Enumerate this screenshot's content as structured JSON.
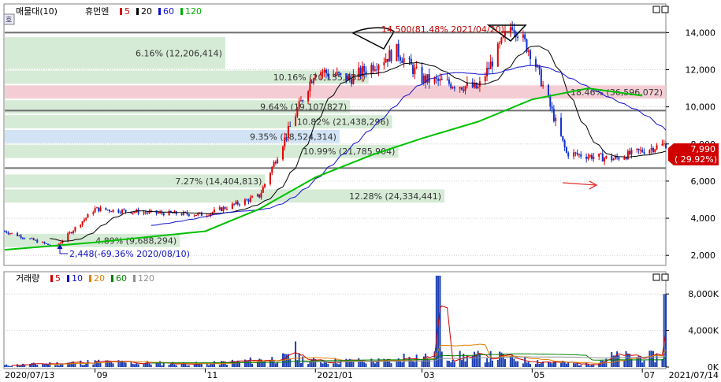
{
  "price_panel": {
    "legend": {
      "title": "매물대(10)",
      "stock": "휴먼엔",
      "ma": [
        {
          "label": "5",
          "color": "#d00000"
        },
        {
          "label": "20",
          "color": "#000000"
        },
        {
          "label": "60",
          "color": "#1010d0"
        },
        {
          "label": "120",
          "color": "#00b000"
        }
      ]
    },
    "y_ticks": [
      "14,000",
      "12,000",
      "10,000",
      "8,000",
      "6,000",
      "4,000",
      "2,000"
    ],
    "current_price": {
      "value": "7,990",
      "change": "( 29.92%)"
    },
    "annotations": {
      "high": "14,500(81.48% 2021/04/20)",
      "low": "2,448(-69.36% 2020/08/10)"
    }
  },
  "volume_panel": {
    "legend": {
      "title": "거래량",
      "ma": [
        {
          "label": "5",
          "color": "#d00000"
        },
        {
          "label": "10",
          "color": "#1010d0"
        },
        {
          "label": "20",
          "color": "#e08000"
        },
        {
          "label": "60",
          "color": "#008000"
        },
        {
          "label": "120",
          "color": "#909090"
        }
      ]
    },
    "y_ticks": [
      "8,000K",
      "4,000K",
      "0K"
    ]
  },
  "x_axis": {
    "labels": [
      "2020/07/13",
      "09",
      "11",
      "2021/01",
      "03",
      "05",
      "07",
      "2021/07/14"
    ]
  },
  "chart_data": {
    "type": "candlestick",
    "title": "휴먼엔",
    "x_range": [
      "2020/07/13",
      "2021/07/14"
    ],
    "ylim": [
      1500,
      15500
    ],
    "volume_profile": [
      {
        "label": "6.16% (12,206,414)",
        "price_low": 12000,
        "price_high": 13800,
        "share": 6.16,
        "volume": 12206414
      },
      {
        "label": "10.16% (20,135,435)",
        "price_low": 11200,
        "price_high": 12000,
        "share": 10.16,
        "volume": 20135435
      },
      {
        "label": "18.46% (36,596,072)",
        "price_low": 10400,
        "price_high": 11200,
        "share": 18.46,
        "volume": 36596072,
        "highlight": true
      },
      {
        "label": "9.64% (19,107,827)",
        "price_low": 9600,
        "price_high": 10400,
        "share": 9.64,
        "volume": 19107827
      },
      {
        "label": "10.82% (21,438,296)",
        "price_low": 8800,
        "price_high": 9600,
        "share": 10.82,
        "volume": 21438296
      },
      {
        "label": "9.35% (18,524,314)",
        "price_low": 8000,
        "price_high": 8800,
        "share": 9.35,
        "volume": 18524314,
        "current": true
      },
      {
        "label": "10.99% (21,785,904)",
        "price_low": 7200,
        "price_high": 8000,
        "share": 10.99,
        "volume": 21785904
      },
      {
        "label": "7.27% (14,404,813)",
        "price_low": 5600,
        "price_high": 6400,
        "share": 7.27,
        "volume": 14404813
      },
      {
        "label": "12.28% (24,334,441)",
        "price_low": 4800,
        "price_high": 5600,
        "share": 12.28,
        "volume": 24334441
      },
      {
        "label": "4.89% (9,688,294)",
        "price_low": 2400,
        "price_high": 3200,
        "share": 4.89,
        "volume": 9688294
      }
    ],
    "horizontal_lines": [
      14000,
      9800,
      6700
    ],
    "price_series": {
      "dates": [
        "2020/07/13",
        "2020/08/10",
        "2020/09/01",
        "2020/10/01",
        "2020/11/01",
        "2020/12/01",
        "2021/01/01",
        "2021/01/20",
        "2021/02/15",
        "2021/03/01",
        "2021/04/01",
        "2021/04/20",
        "2021/05/01",
        "2021/05/20",
        "2021/06/15",
        "2021/07/14"
      ],
      "close": [
        3300,
        2448,
        4500,
        4300,
        4200,
        5200,
        12000,
        11500,
        13000,
        11500,
        11000,
        14500,
        12800,
        7500,
        7200,
        7990
      ]
    },
    "ma120": {
      "dates": [
        "2020/07/13",
        "2020/09/01",
        "2020/11/01",
        "2020/12/01",
        "2021/01/01",
        "2021/02/01",
        "2021/03/01",
        "2021/04/01",
        "2021/05/01",
        "2021/06/01",
        "2021/07/01"
      ],
      "values": [
        2300,
        2700,
        3300,
        4500,
        6200,
        7400,
        8300,
        9200,
        10400,
        11000,
        10600
      ]
    },
    "volume_ylim": [
      0,
      10000
    ],
    "volume_series": {
      "dates": [
        "2020/07/13",
        "2020/09/01",
        "2020/11/01",
        "2020/12/20",
        "2021/01/01",
        "2021/02/15",
        "2021/03/10",
        "2021/04/20",
        "2021/05/15",
        "2021/06/01",
        "2021/07/14"
      ],
      "values_k": [
        500,
        1500,
        900,
        2800,
        1800,
        1700,
        10000,
        2300,
        1300,
        800,
        8000
      ]
    }
  }
}
